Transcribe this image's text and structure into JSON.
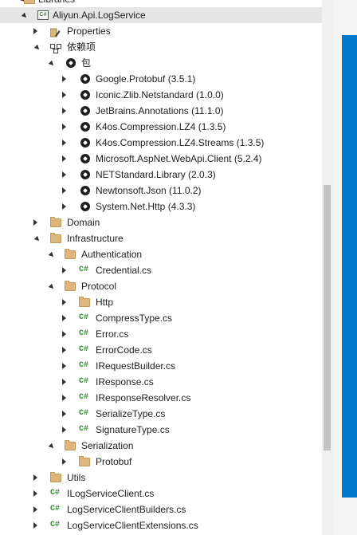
{
  "tree": {
    "libraries_label": "Libraries",
    "project_label": "Aliyun.Api.LogService",
    "properties_label": "Properties",
    "dependencies_label": "依赖项",
    "packages_label": "包",
    "packages": [
      "Google.Protobuf (3.5.1)",
      "Iconic.Zlib.Netstandard (1.0.0)",
      "JetBrains.Annotations (11.1.0)",
      "K4os.Compression.LZ4 (1.3.5)",
      "K4os.Compression.LZ4.Streams (1.3.5)",
      "Microsoft.AspNet.WebApi.Client (5.2.4)",
      "NETStandard.Library (2.0.3)",
      "Newtonsoft.Json (11.0.2)",
      "System.Net.Http (4.3.3)"
    ],
    "domain_label": "Domain",
    "infrastructure_label": "Infrastructure",
    "authentication_label": "Authentication",
    "credential_label": "Credential.cs",
    "protocol_label": "Protocol",
    "http_label": "Http",
    "protocol_files": [
      "CompressType.cs",
      "Error.cs",
      "ErrorCode.cs",
      "IRequestBuilder.cs",
      "IResponse.cs",
      "IResponseResolver.cs",
      "SerializeType.cs",
      "SignatureType.cs"
    ],
    "serialization_label": "Serialization",
    "protobuf_label": "Protobuf",
    "utils_label": "Utils",
    "root_files": [
      "ILogServiceClient.cs",
      "LogServiceClientBuilders.cs",
      "LogServiceClientExtensions.cs"
    ]
  },
  "icons": {
    "folder": "folder-icon",
    "package": "package-icon",
    "csharp": "csharp-file-icon",
    "project": "csharp-project-icon",
    "properties": "wrench-icon",
    "dependencies": "dependencies-icon"
  },
  "colors": {
    "selection": "#cce8ff",
    "csharp_green": "#388a34",
    "folder": "#dcb67a",
    "accent": "#007acc"
  }
}
